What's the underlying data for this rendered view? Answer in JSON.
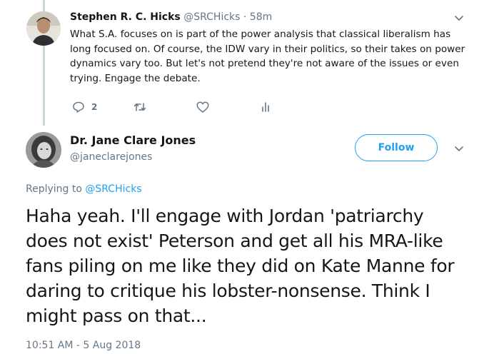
{
  "parent_tweet": {
    "author_name": "Stephen R. C. Hicks",
    "handle": "@SRCHicks",
    "separator": "·",
    "time_ago": "58m",
    "text": "What S.A. focuses on is part of the power analysis that classical liberalism has long focused on. Of course, the IDW vary in their politics,  so their takes on power dynamics vary too. But let's not pretend they're not aware of the issues or even trying. Engage the debate.",
    "reply_count": "2",
    "icons": [
      "reply-icon",
      "retweet-icon",
      "like-icon",
      "analytics-icon",
      "caret-down-icon"
    ]
  },
  "main_tweet": {
    "author_name": "Dr. Jane Clare Jones",
    "handle": "@janeclarejones",
    "follow_label": "Follow",
    "replying_prefix": "Replying to",
    "replying_to": "@SRCHicks",
    "text": "Haha yeah. I'll engage with Jordan 'patriarchy does not exist' Peterson and get all his MRA-like fans piling on me like they did on Kate Manne for daring to critique his lobster-nonsense. Think I might pass on that...",
    "timestamp": "10:51 AM - 5 Aug 2018"
  },
  "colors": {
    "accent": "#1da1f2",
    "secondary_text": "#657786",
    "primary_text": "#14171a",
    "thread_line": "#ccd6dd"
  }
}
